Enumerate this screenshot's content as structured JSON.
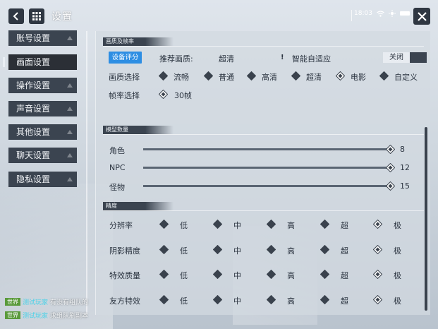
{
  "header": {
    "title": "设置",
    "time": "18:03"
  },
  "sidebar": {
    "items": [
      {
        "label": "账号设置"
      },
      {
        "label": "画面设置",
        "active": true
      },
      {
        "label": "操作设置"
      },
      {
        "label": "声音设置"
      },
      {
        "label": "其他设置"
      },
      {
        "label": "聊天设置"
      },
      {
        "label": "隐私设置"
      }
    ]
  },
  "quality_section": {
    "title": "画质及帧率",
    "device_badge": "设备评分",
    "recommended_label": "推荐画质:",
    "recommended_value": "超清",
    "warn_mark": "!",
    "adaptive_label": "智能自适应",
    "adaptive_toggle": "关闭",
    "quality_label": "画质选择",
    "quality_options": [
      "流畅",
      "普通",
      "高清",
      "超清",
      "电影",
      "自定义"
    ],
    "quality_selected": "电影",
    "fps_label": "帧率选择",
    "fps_options": [
      "30帧"
    ],
    "fps_selected": "30帧"
  },
  "model_section": {
    "title": "模型数量",
    "sliders": [
      {
        "label": "角色",
        "value": "8",
        "fraction": 1.0
      },
      {
        "label": "NPC",
        "value": "12",
        "fraction": 1.0
      },
      {
        "label": "怪物",
        "value": "15",
        "fraction": 1.0
      }
    ]
  },
  "detail_section": {
    "title": "精度",
    "levels": [
      "低",
      "中",
      "高",
      "超",
      "极"
    ],
    "rows": [
      {
        "label": "分辨率",
        "selected": "极"
      },
      {
        "label": "阴影精度",
        "selected": "极"
      },
      {
        "label": "特效质量",
        "selected": "极"
      },
      {
        "label": "友方特效",
        "selected": "极"
      }
    ]
  },
  "chat": {
    "rows": [
      {
        "channel": "世界",
        "name": "测试玩家",
        "message": "有没有组队的"
      },
      {
        "channel": "世界",
        "name": "测试玩家",
        "message": "求组队刷副本"
      }
    ]
  },
  "colors": {
    "accent": "#2d8ee3",
    "nav_bg": "#3b4450",
    "diamond_dark": "#3a424d"
  }
}
